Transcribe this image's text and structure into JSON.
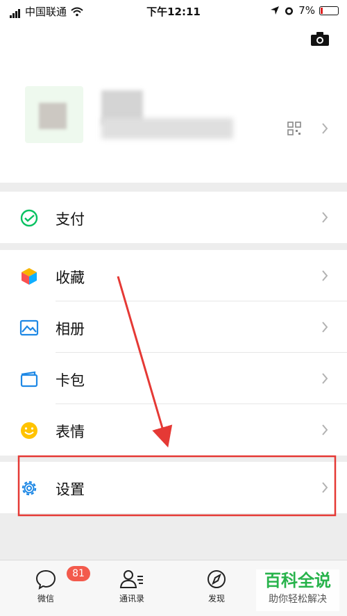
{
  "status": {
    "carrier": "中国联通",
    "time": "下午12:11",
    "battery": "7%"
  },
  "menu": {
    "pay": "支付",
    "favorites": "收藏",
    "album": "相册",
    "cards": "卡包",
    "stickers": "表情",
    "settings": "设置"
  },
  "tabs": {
    "chats": "微信",
    "chats_badge": "81",
    "contacts": "通讯录",
    "discover": "发现"
  },
  "watermark": {
    "title": "百科全说",
    "subtitle": "助你轻松解决"
  },
  "colors": {
    "brand_green": "#07c160",
    "badge_red": "#f35a4c",
    "annotation_red": "#e53935",
    "settings_blue": "#1e88e5"
  }
}
